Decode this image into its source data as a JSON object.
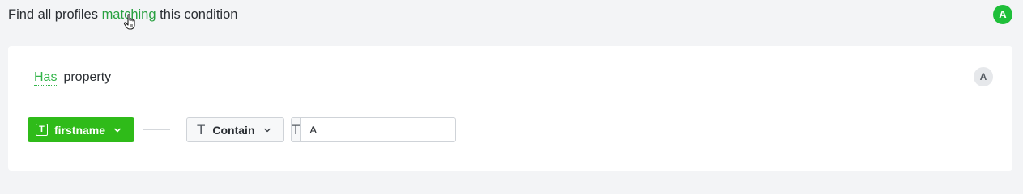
{
  "header": {
    "prefix": "Find all profiles",
    "link_label": "matching",
    "suffix": "this condition",
    "avatar_initial": "A"
  },
  "condition": {
    "has_label": "Has",
    "property_label": "property",
    "avatar_initial": "A",
    "property": {
      "type_icon": "T",
      "name": "firstname"
    },
    "operator": {
      "type_icon": "T",
      "label": "Contain"
    },
    "value": {
      "type_icon": "T",
      "text": "A"
    }
  },
  "colors": {
    "accent": "#2fbb19",
    "link": "#27a03f",
    "avatar_top": "#1fbf3a",
    "avatar_card": "#e6e8eb"
  }
}
